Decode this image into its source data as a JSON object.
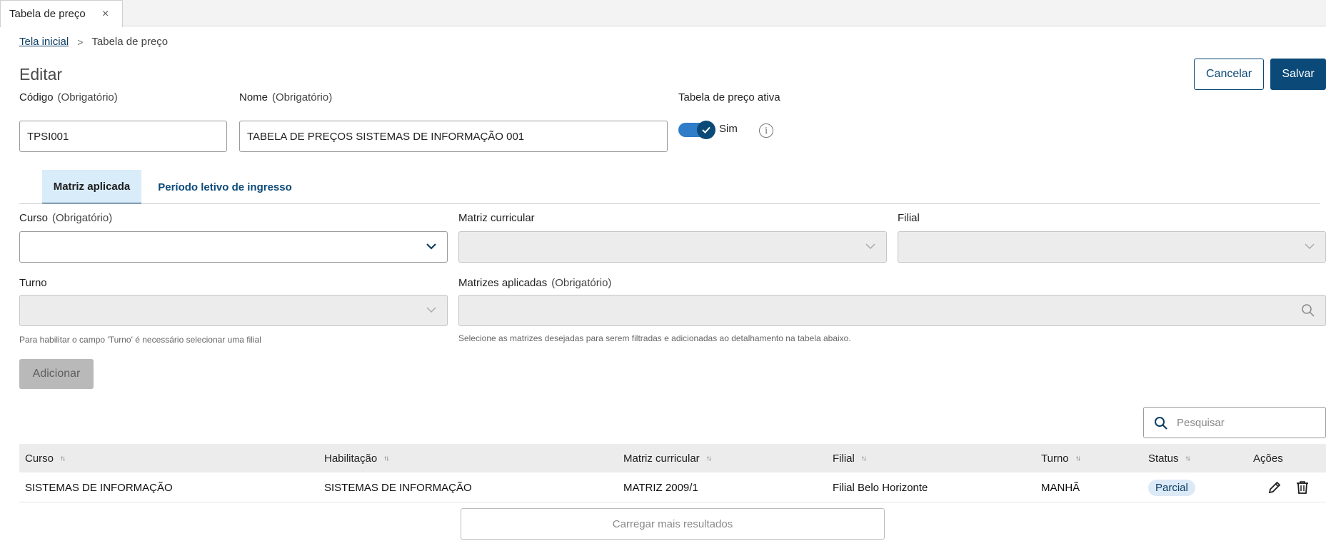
{
  "tab": {
    "label": "Tabela de preço",
    "close_glyph": "×"
  },
  "breadcrumb": {
    "home": "Tela inicial",
    "current": "Tabela de preço"
  },
  "page_title": "Editar",
  "actions": {
    "cancel": "Cancelar",
    "save": "Salvar"
  },
  "form": {
    "codigo": {
      "label": "Código",
      "required": "(Obrigatório)",
      "value": "TPSI001"
    },
    "nome": {
      "label": "Nome",
      "required": "(Obrigatório)",
      "value": "TABELA DE PREÇOS SISTEMAS DE INFORMAÇÃO 001"
    },
    "ativa": {
      "label": "Tabela de preço ativa",
      "value_label": "Sim",
      "on": true,
      "info_glyph": "i"
    }
  },
  "section_tabs": [
    {
      "label": "Matriz aplicada",
      "active": true
    },
    {
      "label": "Período letivo de ingresso",
      "active": false
    }
  ],
  "filters": {
    "curso": {
      "label": "Curso",
      "required": "(Obrigatório)",
      "value": ""
    },
    "matriz_curricular": {
      "label": "Matriz curricular",
      "value": ""
    },
    "filial": {
      "label": "Filial",
      "value": ""
    },
    "turno": {
      "label": "Turno",
      "value": "",
      "hint": "Para habilitar o campo 'Turno' é necessário selecionar uma filial"
    },
    "matrizes_aplicadas": {
      "label": "Matrizes aplicadas",
      "required": "(Obrigatório)",
      "value": "",
      "hint": "Selecione as matrizes desejadas para serem filtradas e adicionadas ao detalhamento na tabela abaixo."
    }
  },
  "add_button": "Adicionar",
  "search": {
    "placeholder": "Pesquisar"
  },
  "table": {
    "sort_glyph": "↑↓",
    "columns": [
      "Curso",
      "Habilitação",
      "Matriz curricular",
      "Filial",
      "Turno",
      "Status",
      "Ações"
    ],
    "rows": [
      {
        "curso": "SISTEMAS DE INFORMAÇÃO",
        "habilitacao": "SISTEMAS DE INFORMAÇÃO",
        "matriz": "MATRIZ 2009/1",
        "filial": "Filial Belo Horizonte",
        "turno": "MANHÃ",
        "status": "Parcial"
      }
    ]
  },
  "load_more": "Carregar mais resultados",
  "colors": {
    "primary": "#0b4a78",
    "toggle_track": "#2f7cc8",
    "active_tab_bg": "#d9ecfa",
    "badge_bg": "#dce9f7"
  }
}
